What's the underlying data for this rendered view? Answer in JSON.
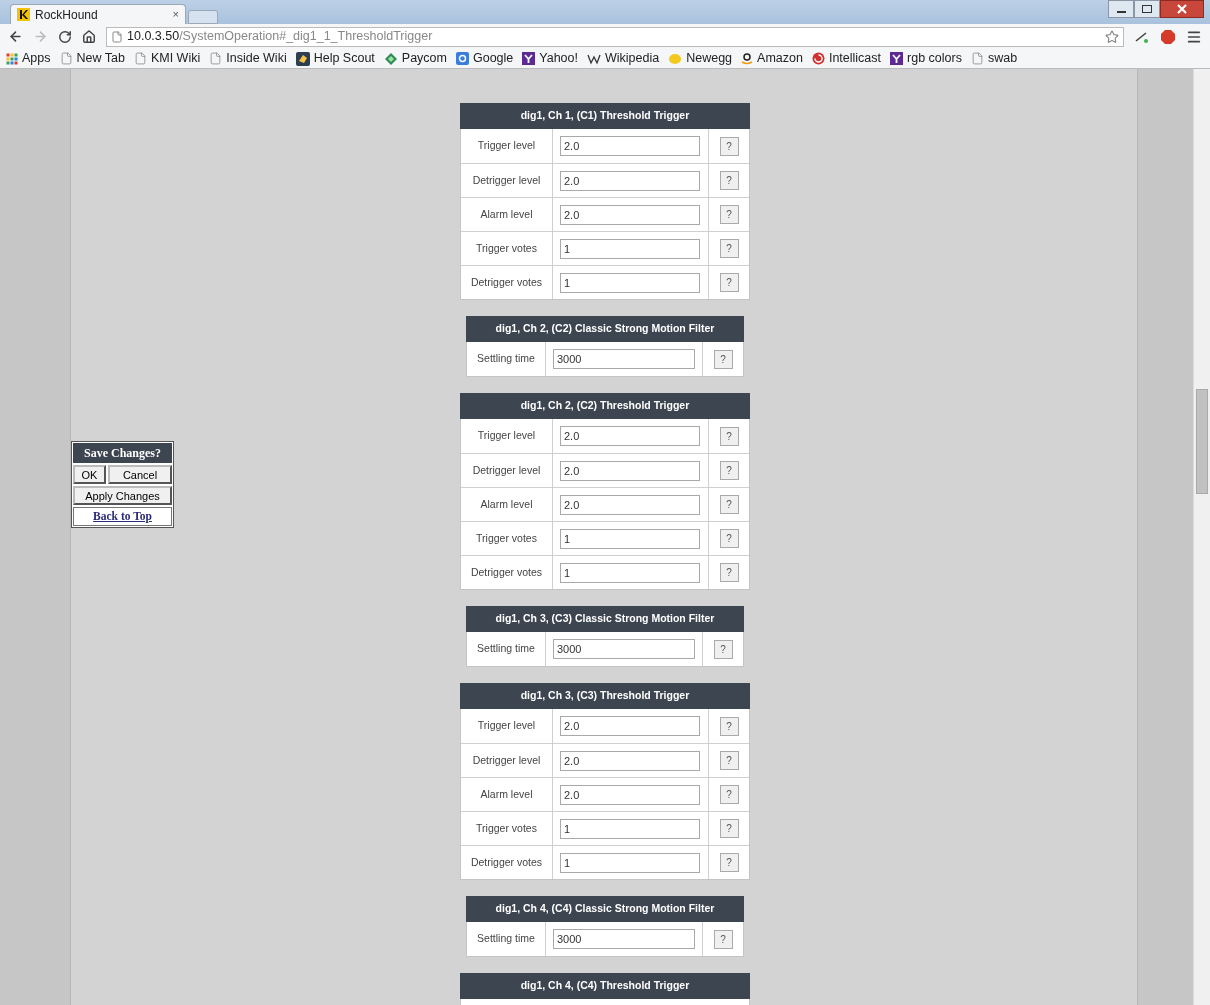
{
  "browser": {
    "tab_title": "RockHound",
    "tab_close": "×",
    "url_host": "10.0.3.50",
    "url_path": "/SystemOperation#_dig1_1_ThresholdTrigger"
  },
  "bookmarks": [
    {
      "kind": "apps",
      "label": "Apps"
    },
    {
      "kind": "page",
      "label": "New Tab"
    },
    {
      "kind": "page",
      "label": "KMI Wiki"
    },
    {
      "kind": "page",
      "label": "Inside Wiki"
    },
    {
      "kind": "helpscout",
      "label": "Help Scout"
    },
    {
      "kind": "paycom",
      "label": "Paycom"
    },
    {
      "kind": "google",
      "label": "Google"
    },
    {
      "kind": "yahoo",
      "label": "Yahoo!"
    },
    {
      "kind": "wiki",
      "label": "Wikipedia"
    },
    {
      "kind": "newegg",
      "label": "Newegg"
    },
    {
      "kind": "amazon",
      "label": "Amazon"
    },
    {
      "kind": "intellicast",
      "label": "Intellicast"
    },
    {
      "kind": "yahoo",
      "label": "rgb colors"
    },
    {
      "kind": "page",
      "label": "swab"
    }
  ],
  "save_panel": {
    "title": "Save Changes?",
    "ok": "OK",
    "cancel": "Cancel",
    "apply": "Apply Changes",
    "back_link": "Back to Top"
  },
  "sections": [
    {
      "kind": "threshold",
      "title": "dig1, Ch 1, (C1) Threshold Trigger",
      "rows": [
        {
          "label": "Trigger level",
          "value": "2.0",
          "help": "?"
        },
        {
          "label": "Detrigger level",
          "value": "2.0",
          "help": "?"
        },
        {
          "label": "Alarm level",
          "value": "2.0",
          "help": "?"
        },
        {
          "label": "Trigger votes",
          "value": "1",
          "help": "?"
        },
        {
          "label": "Detrigger votes",
          "value": "1",
          "help": "?"
        }
      ]
    },
    {
      "kind": "filter",
      "title": "dig1, Ch 2, (C2) Classic Strong Motion Filter",
      "rows": [
        {
          "label": "Settling time",
          "value": "3000",
          "help": "?"
        }
      ]
    },
    {
      "kind": "threshold",
      "title": "dig1, Ch 2, (C2) Threshold Trigger",
      "rows": [
        {
          "label": "Trigger level",
          "value": "2.0",
          "help": "?"
        },
        {
          "label": "Detrigger level",
          "value": "2.0",
          "help": "?"
        },
        {
          "label": "Alarm level",
          "value": "2.0",
          "help": "?"
        },
        {
          "label": "Trigger votes",
          "value": "1",
          "help": "?"
        },
        {
          "label": "Detrigger votes",
          "value": "1",
          "help": "?"
        }
      ]
    },
    {
      "kind": "filter",
      "title": "dig1, Ch 3, (C3) Classic Strong Motion Filter",
      "rows": [
        {
          "label": "Settling time",
          "value": "3000",
          "help": "?"
        }
      ]
    },
    {
      "kind": "threshold",
      "title": "dig1, Ch 3, (C3) Threshold Trigger",
      "rows": [
        {
          "label": "Trigger level",
          "value": "2.0",
          "help": "?"
        },
        {
          "label": "Detrigger level",
          "value": "2.0",
          "help": "?"
        },
        {
          "label": "Alarm level",
          "value": "2.0",
          "help": "?"
        },
        {
          "label": "Trigger votes",
          "value": "1",
          "help": "?"
        },
        {
          "label": "Detrigger votes",
          "value": "1",
          "help": "?"
        }
      ]
    },
    {
      "kind": "filter",
      "title": "dig1, Ch 4, (C4) Classic Strong Motion Filter",
      "rows": [
        {
          "label": "Settling time",
          "value": "3000",
          "help": "?"
        }
      ]
    },
    {
      "kind": "threshold",
      "title": "dig1, Ch 4, (C4) Threshold Trigger",
      "cut_off": true
    }
  ]
}
